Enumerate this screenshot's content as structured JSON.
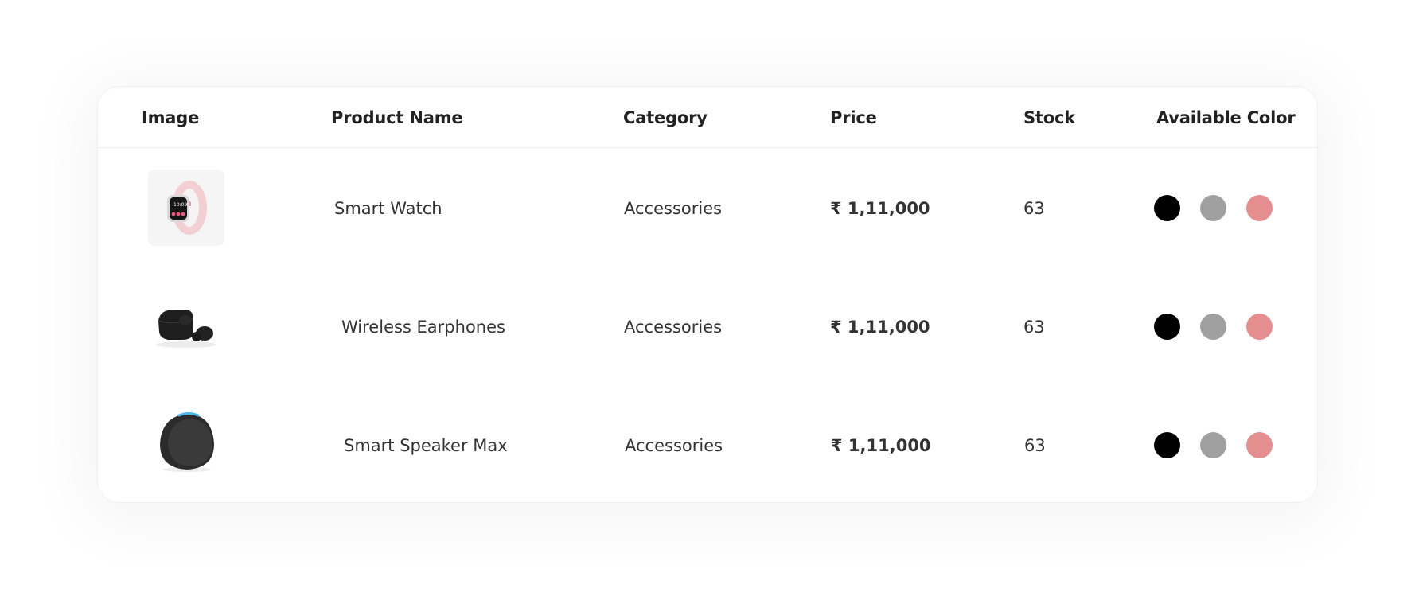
{
  "table": {
    "columns": [
      {
        "key": "image",
        "label": "Image"
      },
      {
        "key": "name",
        "label": "Product Name"
      },
      {
        "key": "category",
        "label": "Category"
      },
      {
        "key": "price",
        "label": "Price"
      },
      {
        "key": "stock",
        "label": "Stock"
      },
      {
        "key": "colors",
        "label": "Available Color"
      }
    ],
    "rows": [
      {
        "image": "smart-watch-image",
        "name": "Smart Watch",
        "category": "Accessories",
        "price": "₹ 1,11,000",
        "stock": "63",
        "colors": [
          "#000000",
          "#a0a0a0",
          "#e58e8f"
        ]
      },
      {
        "image": "wireless-earphones-image",
        "name": "Wireless Earphones",
        "category": "Accessories",
        "price": "₹ 1,11,000",
        "stock": "63",
        "colors": [
          "#000000",
          "#a0a0a0",
          "#e58e8f"
        ]
      },
      {
        "image": "smart-speaker-image",
        "name": "Smart Speaker Max",
        "category": "Accessories",
        "price": "₹ 1,11,000",
        "stock": "63",
        "colors": [
          "#000000",
          "#a0a0a0",
          "#e58e8f"
        ]
      }
    ]
  }
}
